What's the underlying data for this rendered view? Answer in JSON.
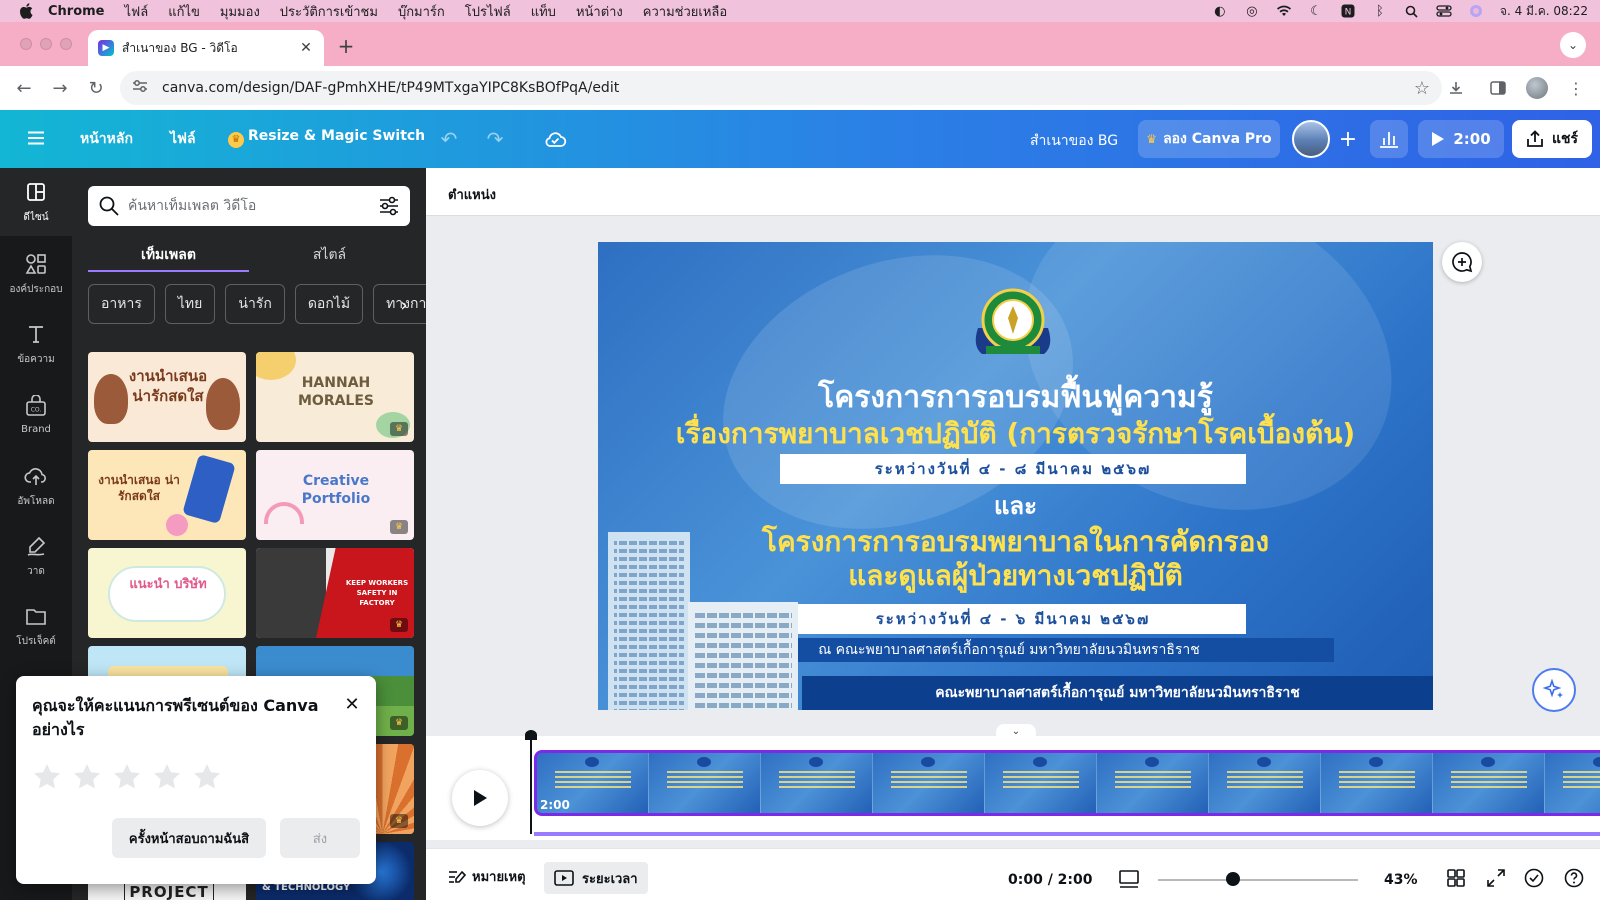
{
  "menubar": {
    "app": "Chrome",
    "items": [
      "ไฟล์",
      "แก้ไข",
      "มุมมอง",
      "ประวัติการเข้าชม",
      "บุ๊กมาร์ก",
      "โปรไฟล์",
      "แท็บ",
      "หน้าต่าง",
      "ความช่วยเหลือ"
    ],
    "datetime": "จ. 4 มี.ค.  08:22"
  },
  "browser": {
    "tab_title": "สำเนาของ BG - วิดีโอ",
    "url": "canva.com/design/DAF-gPmhXHE/tP49MTxgaYIPC8KsBOfPqA/edit"
  },
  "header": {
    "home": "หน้าหลัก",
    "file": "ไฟล์",
    "resize": "Resize & Magic Switch",
    "doc_title": "สำเนาของ BG",
    "pro": "ลอง Canva Pro",
    "play_time": "2:00",
    "share": "แชร์"
  },
  "rail": {
    "items": [
      {
        "label": "ดีไซน์",
        "icon": "design-icon"
      },
      {
        "label": "องค์ประกอบ",
        "icon": "elements-icon"
      },
      {
        "label": "ข้อความ",
        "icon": "text-icon"
      },
      {
        "label": "Brand",
        "icon": "brand-icon"
      },
      {
        "label": "อัพโหลด",
        "icon": "upload-icon"
      },
      {
        "label": "วาด",
        "icon": "draw-icon"
      },
      {
        "label": "โปรเจ็คต์",
        "icon": "folder-icon"
      }
    ]
  },
  "panel": {
    "search_placeholder": "ค้นหาเท็มเพลต วิดีโอ",
    "tabs": [
      "เท็มเพลต",
      "สไตล์"
    ],
    "chips": [
      "อาหาร",
      "ไทย",
      "น่ารัก",
      "ดอกไม้",
      "ทางการ"
    ],
    "thumbs": {
      "t1": "งานนำเสนอ น่ารักสดใส",
      "t2": "HANNAH MORALES",
      "t3": "งานนำเสนอ น่ารักสดใส",
      "t4": "Creative Portfolio",
      "t5": "แนะนำ บริษัท",
      "t6": "KEEP WORKERS SAFETY IN FACTORY",
      "t10": "PROJECT",
      "t11": "& TECHNOLOGY"
    }
  },
  "rating": {
    "title": "คุณจะให้คะแนนการพรีเซนต์ของ Canva อย่างไร",
    "later": "ครั้งหน้าสอบถามฉันสิ",
    "send": "ส่ง",
    "stars": 5
  },
  "editor": {
    "position": "ตำแหน่ง"
  },
  "slide": {
    "title1": "โครงการการอบรมฟื้นฟูความรู้",
    "title2": "เรื่องการพยาบาลเวชปฏิบัติ (การตรวจรักษาโรคเบื้องต้น)",
    "date1": "ระหว่างวันที่ ๔ - ๘ มีนาคม ๒๕๖๗",
    "and": "และ",
    "title3": "โครงการการอบรมพยาบาลในการคัดกรอง",
    "title4": "และดูแลผู้ป่วยทางเวชปฏิบัติ",
    "date2": "ระหว่างวันที่ ๔ - ๖ มีนาคม ๒๕๖๗",
    "venue": "ณ คณะพยาบาลศาสตร์เกื้อการุณย์ มหาวิทยาลัยนวมินทราธิราช",
    "footer": "คณะพยาบาลศาสตร์เกื้อการุณย์  มหาวิทยาลัยนวมินทราธิราช"
  },
  "timeline": {
    "clip_duration": "2:00"
  },
  "footer": {
    "notes": "หมายเหตุ",
    "duration": "ระยะเวลา",
    "time": "0:00 / 2:00",
    "zoom": "43%",
    "zoom_fraction": 0.43
  },
  "colors": {
    "accent": "#7d2ae8",
    "header_start": "#13b6d4",
    "header_end": "#2f62e6",
    "slide_yellow": "#ffe14d"
  }
}
